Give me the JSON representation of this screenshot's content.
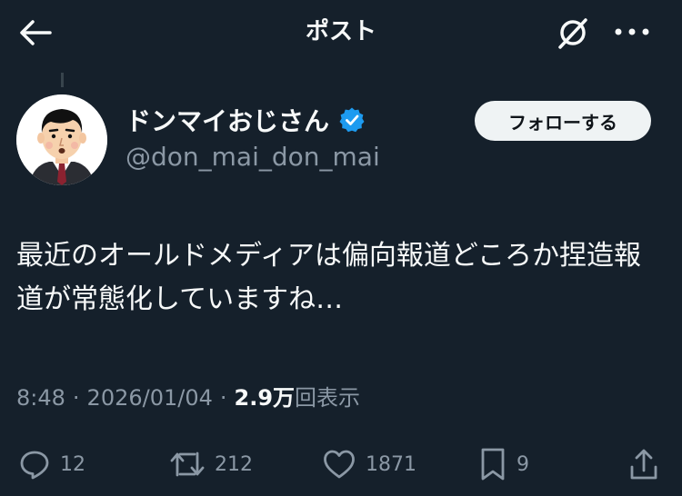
{
  "header": {
    "title": "ポスト"
  },
  "author": {
    "display_name": "ドンマイおじさん",
    "handle": "@don_mai_don_mai",
    "follow_label": "フォローする"
  },
  "post": {
    "text": "最近のオールドメディアは偏向報道どころか捏造報道が常態化していますね…",
    "time": "8:48",
    "separator": "·",
    "date": "2026/01/04",
    "views_count": "2.9",
    "views_unit": "万",
    "views_label": "回表示"
  },
  "actions": {
    "replies": "12",
    "reposts": "212",
    "likes": "1871",
    "bookmarks": "9"
  },
  "colors": {
    "background": "#15202b",
    "text_primary": "#f7f9f9",
    "text_secondary": "#8b98a5",
    "verified": "#1d9bf0",
    "follow_button_bg": "#eff3f4"
  }
}
